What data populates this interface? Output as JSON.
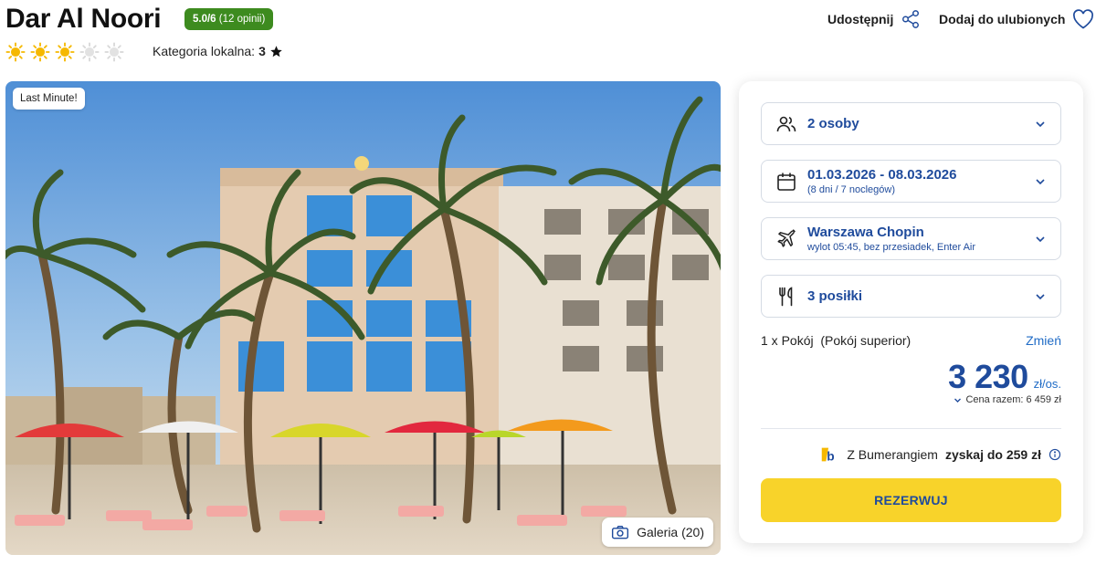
{
  "hotel": {
    "name": "Dar Al Noori",
    "rating_score": "5.0/6",
    "rating_count": "(12 opinii)",
    "suns_total": 5,
    "suns_filled": 3,
    "local_category_label": "Kategoria lokalna:",
    "local_category_value": "3",
    "local_category_icon": "star-icon"
  },
  "actions": {
    "share_label": "Udostępnij",
    "share_icon": "share-icon",
    "favorite_label": "Dodaj do ulubionych",
    "favorite_icon": "heart-icon"
  },
  "photo": {
    "badge": "Last Minute!",
    "gallery_label": "Galeria (20)",
    "gallery_icon": "camera-icon"
  },
  "booking": {
    "persons": {
      "icon": "people-icon",
      "label": "2 osoby"
    },
    "dates": {
      "icon": "calendar-icon",
      "label": "01.03.2026 - 08.03.2026",
      "sub": "(8 dni / 7 noclegów)"
    },
    "flight": {
      "icon": "plane-icon",
      "label": "Warszawa Chopin",
      "sub": "wylot 05:45, bez przesiadek, Enter Air"
    },
    "meals": {
      "icon": "cutlery-icon",
      "label": "3 posiłki"
    },
    "room": "1 x Pokój  (Pokój superior)",
    "room_change": "Zmień",
    "price": "3 230",
    "price_unit": "zł/os.",
    "total": "Cena razem: 6 459 zł",
    "bumerang_prefix": "Z Bumerangiem",
    "bumerang_bold": "zyskaj do 259 zł",
    "bumerang_icon": "bumerang-logo-icon",
    "info_icon": "info-icon",
    "reserve_label": "REZERWUJ"
  },
  "colors": {
    "brand_blue": "#1f4b9c",
    "link_blue": "#1f6bc6",
    "reserve_yellow": "#f8d32a",
    "rating_green": "#3d8b1f",
    "sun_yellow": "#f5b800"
  }
}
